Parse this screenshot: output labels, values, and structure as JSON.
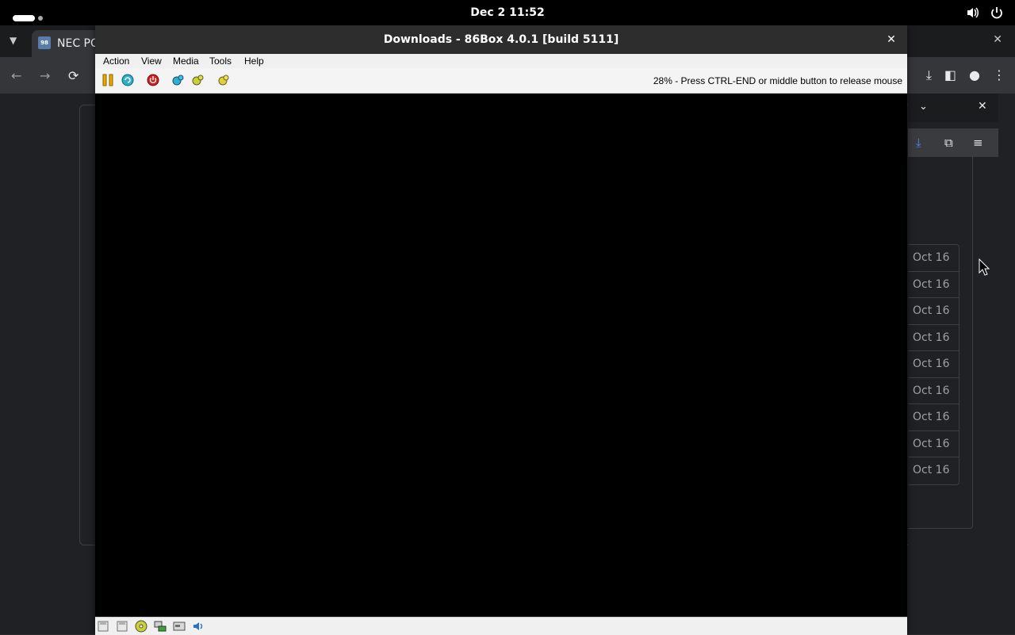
{
  "topbar": {
    "clock": "Dec 2  11:52"
  },
  "browser": {
    "tab_title": "NEC PC",
    "favicon_text": "98"
  },
  "downloads_panel": {
    "dates": [
      "Oct 16",
      "Oct 16",
      "Oct 16",
      "Oct 16",
      "Oct 16",
      "Oct 16",
      "Oct 16",
      "Oct 16",
      "Oct 16"
    ]
  },
  "box86": {
    "title": "Downloads - 86Box 4.0.1 [build 5111]",
    "menu": [
      "Action",
      "View",
      "Media",
      "Tools",
      "Help"
    ],
    "status_text": "28% - Press CTRL-END or middle button to release mouse",
    "toolbar_icons": [
      "pause-icon",
      "ctrl-alt-del-icon",
      "power-icon",
      "settings-icon",
      "hard-reset-icon",
      "screenshot-icon"
    ],
    "statusbar_icons": [
      "floppy-a-icon",
      "floppy-b-icon",
      "cdrom-icon",
      "network-icon",
      "hdd-icon",
      "sound-icon"
    ]
  }
}
